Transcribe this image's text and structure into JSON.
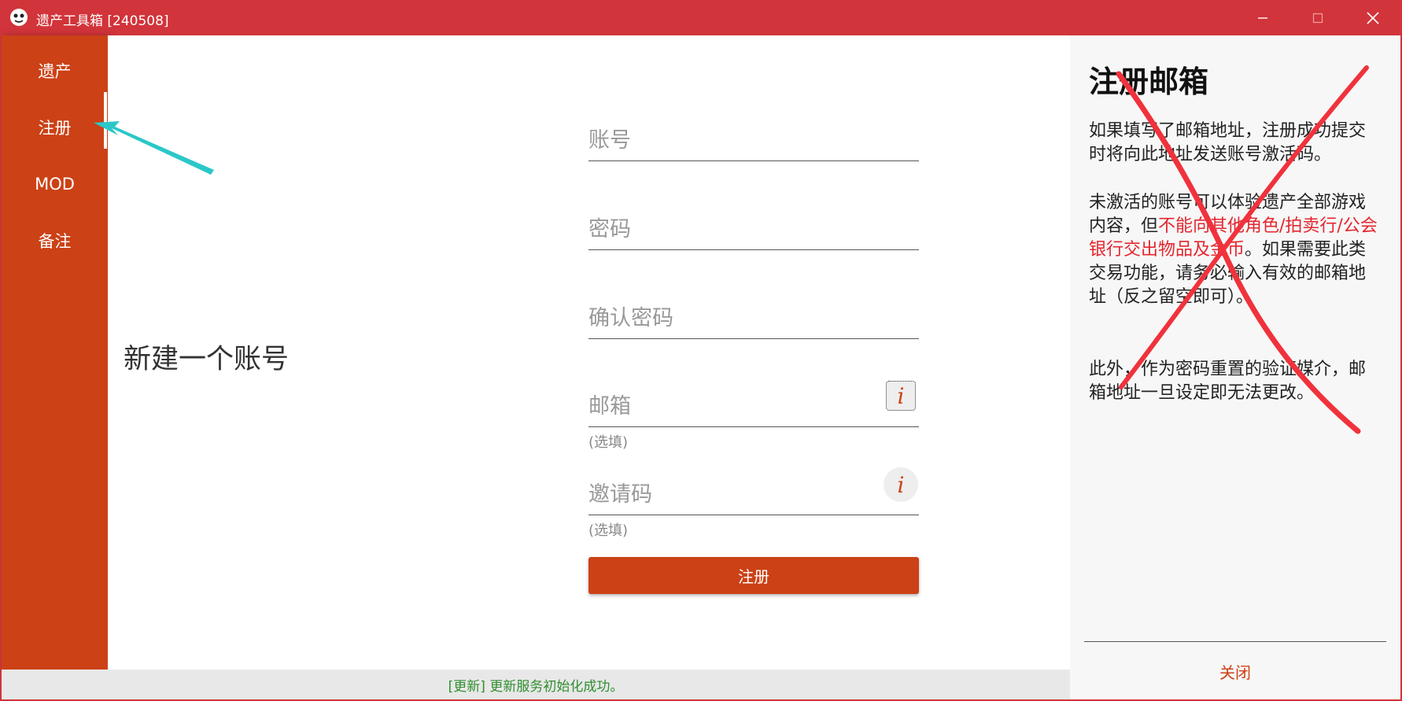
{
  "window": {
    "title": "遗产工具箱 [240508]",
    "accent": "#d1343a"
  },
  "sidebar": {
    "color": "#cc4116",
    "items": [
      {
        "label": "遗产"
      },
      {
        "label": "注册"
      },
      {
        "label": "MOD"
      },
      {
        "label": "备注"
      }
    ],
    "active": "注册"
  },
  "form": {
    "title": "新建一个账号",
    "account_placeholder": "账号",
    "password_placeholder": "密码",
    "confirm_placeholder": "确认密码",
    "email_placeholder": "邮箱",
    "email_hint": "(选填)",
    "invite_placeholder": "邀请码",
    "invite_hint": "(选填)",
    "info_glyph": "i",
    "submit_label": "注册"
  },
  "status": {
    "text": "[更新] 更新服务初始化成功。",
    "color": "#2f8f2f"
  },
  "help": {
    "title": "注册邮箱",
    "para1": "如果填写了邮箱地址，注册成功提交时将向此地址发送账号激活码。",
    "para2_prefix": "未激活的账号可以体验遗产全部游戏内容，但",
    "para2_warn": "不能向其他角色/拍卖行/公会银行交出物品及金币",
    "para2_suffix": "。如果需要此类交易功能，请务必输入有效的邮箱地址（反之留空即可）。",
    "para3": "此外，作为密码重置的验证媒介，邮箱地址一旦设定即无法更改。",
    "close_label": "关闭",
    "warn_color": "#e4262f"
  }
}
